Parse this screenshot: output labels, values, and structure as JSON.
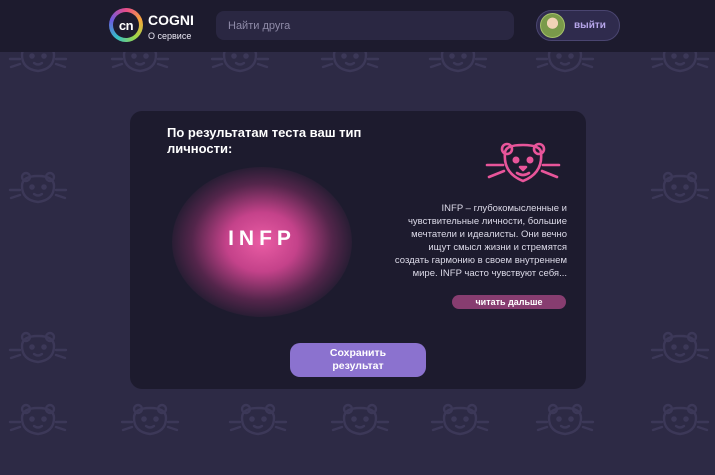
{
  "header": {
    "logo_text": "cn",
    "brand_name": "COGNI",
    "about_label": "О сервисе",
    "search": {
      "placeholder": "Найти друга",
      "value": ""
    },
    "user": {
      "logout_label": "выйти"
    }
  },
  "result": {
    "title": "По результатам теста ваш тип личности:",
    "type_code": "INFP",
    "description": "INFP – глубокомысленные и чувствительные личности, большие мечтатели и идеалисты. Они вечно ищут смысл жизни и стремятся создать гармонию в своем внутреннем мире. INFP часто чувствуют себя...",
    "read_more_label": "читать дальше",
    "save_label": "Сохранить результат"
  },
  "colors": {
    "background": "#2d2a45",
    "panel": "#1d1b2e",
    "accent_pink": "#ea5ca4",
    "accent_purple": "#8b72cf",
    "read_more": "#873d70"
  },
  "icons": {
    "mascot": "tiger-face-icon",
    "background_pattern": "tiger-face-icon"
  }
}
